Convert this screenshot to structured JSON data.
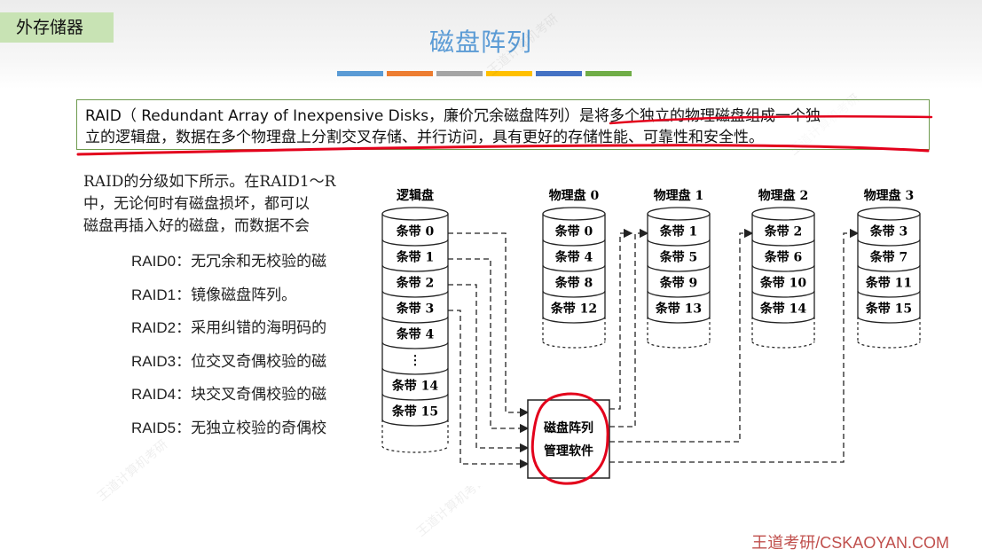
{
  "section_tag": "外存储器",
  "title": "磁盘阵列",
  "accent_bar_colors": [
    "#5b9bd5",
    "#ed7d31",
    "#a5a5a5",
    "#ffc000",
    "#4472c4",
    "#70ad47"
  ],
  "definition": {
    "line1": "RAID（ Redundant Array of Inexpensive Disks，廉价冗余磁盘阵列）是将多个独立的物理磁盘组成一个独",
    "line2": "立的逻辑盘，数据在多个物理盘上分割交叉存储、并行访问，具有更好的存储性能、可靠性和安全性。"
  },
  "intro": {
    "line1": "RAID的分级如下所示。在RAID1～R",
    "line2": "中，无论何时有磁盘损坏，都可以",
    "line3": "磁盘再插入好的磁盘，而数据不会"
  },
  "raid_levels": [
    {
      "code": "RAID0：",
      "desc": "无冗余和无校验的磁"
    },
    {
      "code": "RAID1：",
      "desc": "镜像磁盘阵列。"
    },
    {
      "code": "RAID2：",
      "desc": "采用纠错的海明码的"
    },
    {
      "code": "RAID3：",
      "desc": "位交叉奇偶校验的磁"
    },
    {
      "code": "RAID4：",
      "desc": "块交叉奇偶校验的磁"
    },
    {
      "code": "RAID5：",
      "desc": "无独立校验的奇偶校"
    }
  ],
  "diagram": {
    "logical_disk": {
      "label": "逻辑盘",
      "stripes_top": [
        "条带 0",
        "条带 1",
        "条带 2",
        "条带 3",
        "条带 4"
      ],
      "ellipsis": "⋮",
      "stripes_bottom": [
        "条带 14",
        "条带 15"
      ]
    },
    "physical_disks": [
      {
        "label": "物理盘 0",
        "stripes": [
          "条带 0",
          "条带 4",
          "条带 8",
          "条带 12"
        ]
      },
      {
        "label": "物理盘 1",
        "stripes": [
          "条带 1",
          "条带 5",
          "条带 9",
          "条带 13"
        ]
      },
      {
        "label": "物理盘 2",
        "stripes": [
          "条带 2",
          "条带 6",
          "条带 10",
          "条带 14"
        ]
      },
      {
        "label": "物理盘 3",
        "stripes": [
          "条带 3",
          "条带 7",
          "条带 11",
          "条带 15"
        ]
      }
    ],
    "software_box": {
      "line1": "磁盘阵列",
      "line2": "管理软件"
    }
  },
  "footer": "王道考研/CSKAOYAN.COM",
  "highlight_color": "#e3001b"
}
